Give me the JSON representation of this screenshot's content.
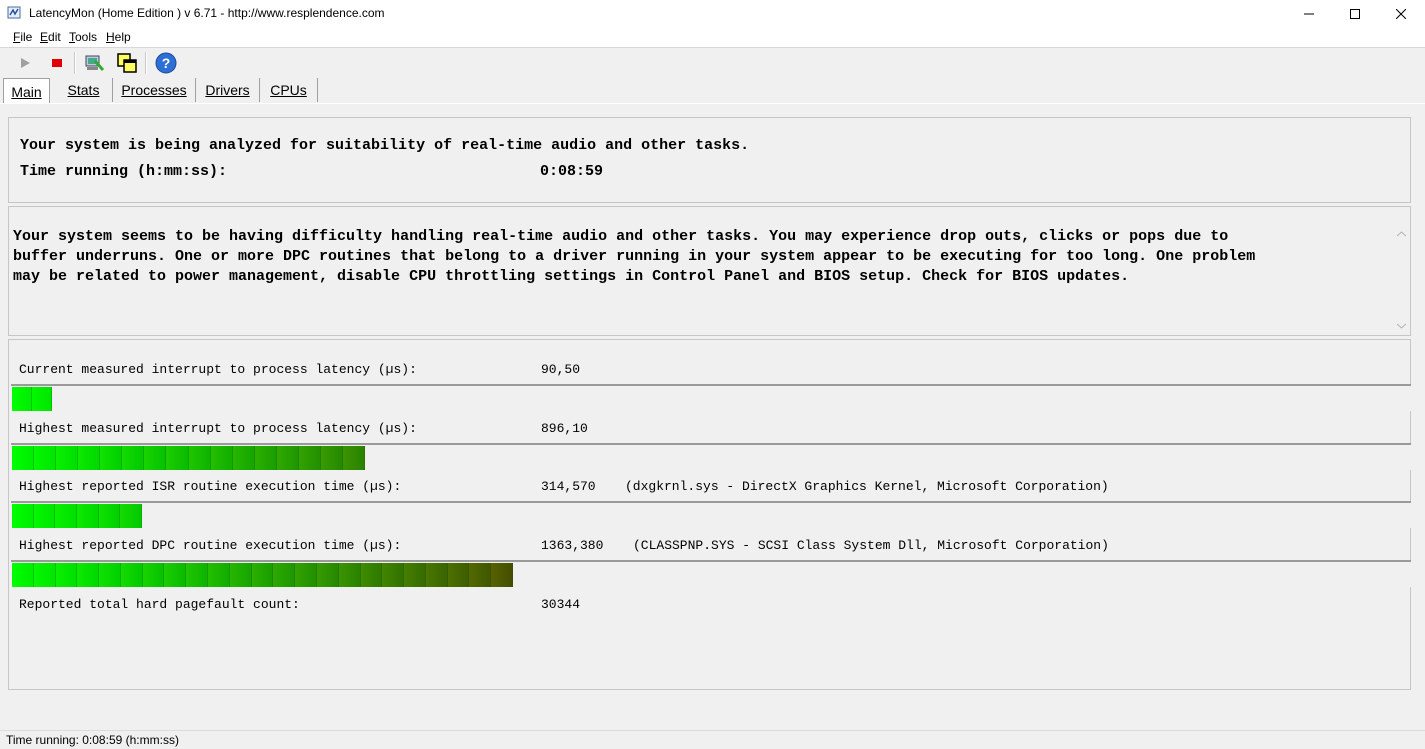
{
  "window": {
    "title": "LatencyMon  (Home Edition )  v 6.71 - http://www.resplendence.com"
  },
  "menu": {
    "items": [
      {
        "label": "File",
        "mnemonic": "F",
        "rest": "ile"
      },
      {
        "label": "Edit",
        "mnemonic": "E",
        "rest": "dit"
      },
      {
        "label": "Tools",
        "mnemonic": "T",
        "rest": "ools"
      },
      {
        "label": "Help",
        "mnemonic": "H",
        "rest": "elp"
      }
    ]
  },
  "toolbar": {
    "icons": [
      "play-icon",
      "stop-icon",
      "hardware-icon",
      "windows-icon",
      "help-icon"
    ]
  },
  "tabs": [
    {
      "label": "Main",
      "active": true
    },
    {
      "label": "Stats",
      "active": false
    },
    {
      "label": "Processes",
      "active": false
    },
    {
      "label": "Drivers",
      "active": false
    },
    {
      "label": "CPUs",
      "active": false
    }
  ],
  "status_panel": {
    "analysis_text": "Your system is being analyzed for suitability of real-time audio and other tasks.",
    "time_label": "Time running (h:mm:ss):",
    "time_value": "0:08:59"
  },
  "conclusion": {
    "lines": [
      "Your system seems to be having difficulty handling real-time audio and other tasks. You may experience drop outs, clicks or pops due to",
      "buffer underruns. One or more DPC routines that belong to a driver running in your system appear to be executing for too long. One problem",
      "may be related to power management, disable CPU throttling settings in Control Panel and BIOS setup. Check for BIOS updates."
    ]
  },
  "metrics": [
    {
      "label": "Current measured interrupt to process latency (µs):",
      "value": "90,50",
      "detail": "",
      "bar_fraction": 0.029
    },
    {
      "label": "Highest measured interrupt to process latency (µs):",
      "value": "896,10",
      "detail": "",
      "bar_fraction": 0.253
    },
    {
      "label": "Highest reported ISR routine execution time (µs):",
      "value": "314,570",
      "detail": "(dxgkrnl.sys - DirectX Graphics Kernel, Microsoft Corporation)",
      "bar_fraction": 0.093
    },
    {
      "label": "Highest reported DPC routine execution time (µs):",
      "value": "1363,380",
      "detail": "(CLASSPNP.SYS - SCSI Class System Dll, Microsoft Corporation)",
      "bar_fraction": 0.359
    },
    {
      "label": "Reported total hard pagefault count:",
      "value": "30344",
      "detail": ""
    }
  ],
  "statusbar": {
    "text": "Time running: 0:08:59  (h:mm:ss)"
  },
  "colors": {
    "bar_start": "#00ff00",
    "bar_end": "#5a5a00"
  }
}
